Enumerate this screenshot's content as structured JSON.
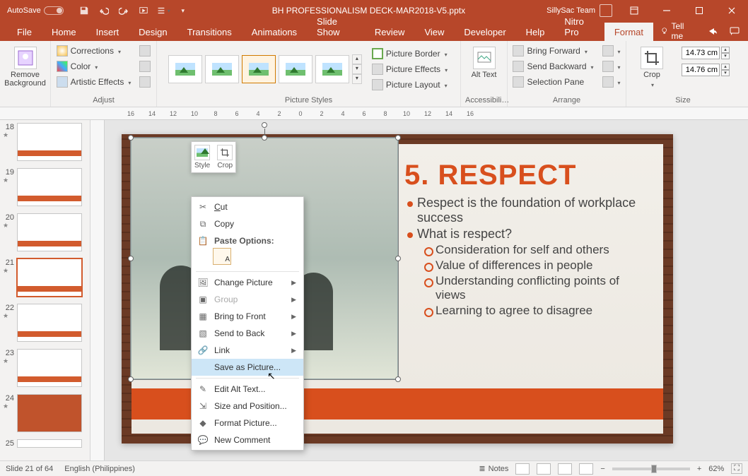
{
  "titlebar": {
    "autosave_label": "AutoSave",
    "autosave_state": "Off",
    "doc_title": "BH PROFESSIONALISM DECK-MAR2018-V5.pptx",
    "account": "SillySac Team"
  },
  "tabs": {
    "items": [
      "File",
      "Home",
      "Insert",
      "Design",
      "Transitions",
      "Animations",
      "Slide Show",
      "Review",
      "View",
      "Developer",
      "Help",
      "Nitro Pro",
      "Format"
    ],
    "active": "Format",
    "tell_me": "Tell me"
  },
  "ribbon": {
    "remove_bg": "Remove Background",
    "adjust": {
      "corrections": "Corrections",
      "color": "Color",
      "artistic": "Artistic Effects",
      "label": "Adjust"
    },
    "picture_styles_label": "Picture Styles",
    "border": "Picture Border",
    "effects": "Picture Effects",
    "layout": "Picture Layout",
    "alt_text": "Alt Text",
    "accessibility_label": "Accessibili…",
    "bring_forward": "Bring Forward",
    "send_backward": "Send Backward",
    "selection_pane": "Selection Pane",
    "arrange_label": "Arrange",
    "crop": "Crop",
    "height": "14.73 cm",
    "width": "14.76 cm",
    "size_label": "Size"
  },
  "ruler": [
    "16",
    "14",
    "12",
    "10",
    "8",
    "6",
    "4",
    "2",
    "0",
    "2",
    "4",
    "6",
    "8",
    "10",
    "12",
    "14",
    "16"
  ],
  "thumbs": [
    {
      "num": "18"
    },
    {
      "num": "19"
    },
    {
      "num": "20"
    },
    {
      "num": "21",
      "selected": true
    },
    {
      "num": "22"
    },
    {
      "num": "23"
    },
    {
      "num": "24"
    },
    {
      "num": "25"
    }
  ],
  "slide": {
    "title": "5. RESPECT",
    "b1a": "Respect is the foundation of workplace success",
    "b1b": "What is respect?",
    "b2a": "Consideration for self and others",
    "b2b": "Value of differences in people",
    "b2c": "Understanding conflicting points of views",
    "b2d": "Learning to agree to disagree"
  },
  "mini_toolbar": {
    "style": "Style",
    "crop": "Crop"
  },
  "context_menu": {
    "cut": "Cut",
    "copy": "Copy",
    "paste_options": "Paste Options:",
    "change_picture": "Change Picture",
    "group": "Group",
    "bring_front": "Bring to Front",
    "send_back": "Send to Back",
    "link": "Link",
    "save_as_picture": "Save as Picture...",
    "edit_alt": "Edit Alt Text...",
    "size_pos": "Size and Position...",
    "format_picture": "Format Picture...",
    "new_comment": "New Comment"
  },
  "status": {
    "slide": "Slide 21 of 64",
    "lang": "English (Philippines)",
    "notes": "Notes",
    "zoom": "62%"
  }
}
